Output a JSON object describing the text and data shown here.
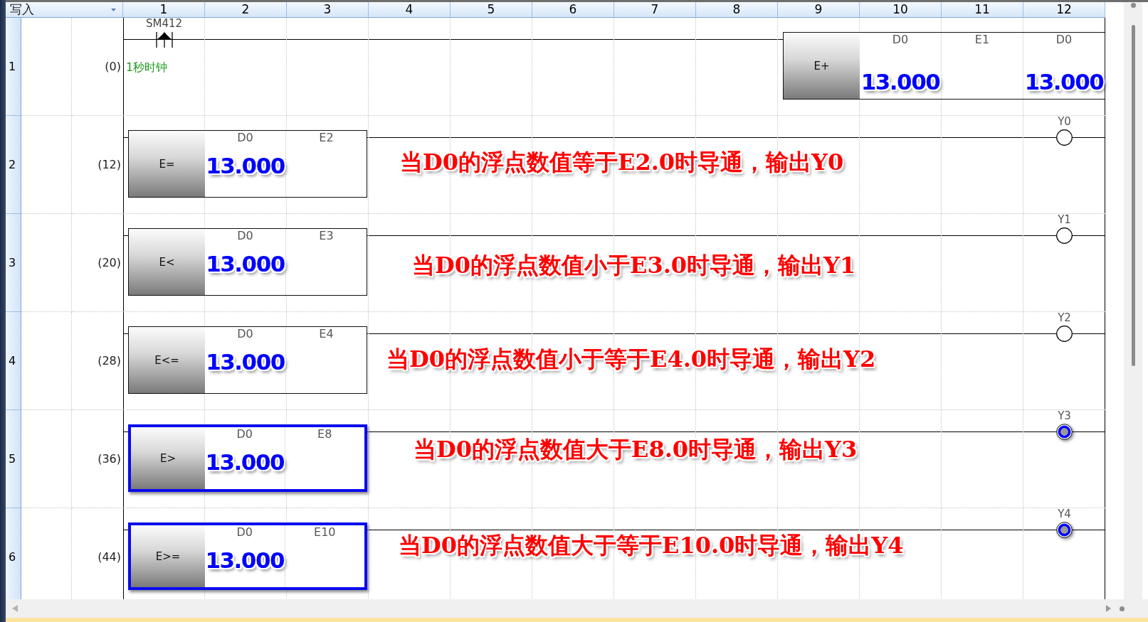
{
  "header": {
    "mode": "写入",
    "columns": [
      "1",
      "2",
      "3",
      "4",
      "5",
      "6",
      "7",
      "8",
      "9",
      "10",
      "11",
      "12"
    ]
  },
  "rungs": [
    {
      "row_number": "1",
      "step": "(0)",
      "contact": {
        "kind": "rising_edge",
        "device": "SM412"
      },
      "comment": "1秒时钟",
      "block": {
        "kind": "operation",
        "instruction": "E+",
        "highlighted": false,
        "operands": [
          {
            "device": "D0",
            "value": "13.000"
          },
          {
            "device": "E1"
          },
          {
            "device": "D0",
            "value": "13.000"
          }
        ]
      }
    },
    {
      "row_number": "2",
      "step": "(12)",
      "block": {
        "kind": "comparison",
        "instruction": "E=",
        "highlighted": false,
        "operands": [
          {
            "device": "D0",
            "value": "13.000"
          },
          {
            "device": "E2"
          }
        ]
      },
      "coil": {
        "device": "Y0",
        "energized": false
      },
      "annotation": "当D0的浮点数值等于E2.0时导通，输出Y0"
    },
    {
      "row_number": "3",
      "step": "(20)",
      "block": {
        "kind": "comparison",
        "instruction": "E<",
        "highlighted": false,
        "operands": [
          {
            "device": "D0",
            "value": "13.000"
          },
          {
            "device": "E3"
          }
        ]
      },
      "coil": {
        "device": "Y1",
        "energized": false
      },
      "annotation": "当D0的浮点数值小于E3.0时导通，输出Y1"
    },
    {
      "row_number": "4",
      "step": "(28)",
      "block": {
        "kind": "comparison",
        "instruction": "E<=",
        "highlighted": false,
        "operands": [
          {
            "device": "D0",
            "value": "13.000"
          },
          {
            "device": "E4"
          }
        ]
      },
      "coil": {
        "device": "Y2",
        "energized": false
      },
      "annotation": "当D0的浮点数值小于等于E4.0时导通，输出Y2"
    },
    {
      "row_number": "5",
      "step": "(36)",
      "block": {
        "kind": "comparison",
        "instruction": "E>",
        "highlighted": true,
        "operands": [
          {
            "device": "D0",
            "value": "13.000"
          },
          {
            "device": "E8"
          }
        ]
      },
      "coil": {
        "device": "Y3",
        "energized": true
      },
      "annotation": "当D0的浮点数值大于E8.0时导通，输出Y3"
    },
    {
      "row_number": "6",
      "step": "(44)",
      "block": {
        "kind": "comparison",
        "instruction": "E>=",
        "highlighted": true,
        "operands": [
          {
            "device": "D0",
            "value": "13.000"
          },
          {
            "device": "E10"
          }
        ]
      },
      "coil": {
        "device": "Y4",
        "energized": true
      },
      "annotation": "当D0的浮点数值大于等于E10.0时导通，输出Y4"
    }
  ]
}
